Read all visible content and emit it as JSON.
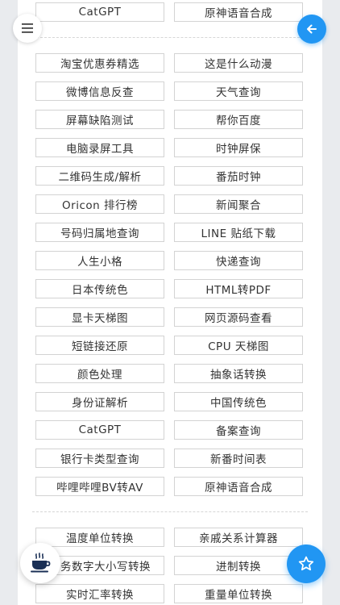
{
  "top_row": [
    "CatGPT",
    "原神语音合成"
  ],
  "tools": [
    [
      "淘宝优惠券精选",
      "这是什么动漫"
    ],
    [
      "微博信息反查",
      "天气查询"
    ],
    [
      "屏幕缺陷测试",
      "帮你百度"
    ],
    [
      "电脑录屏工具",
      "时钟屏保"
    ],
    [
      "二维码生成/解析",
      "番茄时钟"
    ],
    [
      "Oricon 排行榜",
      "新闻聚合"
    ],
    [
      "号码归属地查询",
      "LINE 贴纸下载"
    ],
    [
      "人生小格",
      "快递查询"
    ],
    [
      "日本传统色",
      "HTML转PDF"
    ],
    [
      "显卡天梯图",
      "网页源码查看"
    ],
    [
      "短链接还原",
      "CPU 天梯图"
    ],
    [
      "颜色处理",
      "抽象话转换"
    ],
    [
      "身份证解析",
      "中国传统色"
    ],
    [
      "CatGPT",
      "备案查询"
    ],
    [
      "银行卡类型查询",
      "新番时间表"
    ],
    [
      "哔哩哔哩BV转AV",
      "原神语音合成"
    ]
  ],
  "converters": [
    [
      "温度单位转换",
      "亲戚关系计算器"
    ],
    [
      "财务数字大小写转换",
      "进制转换"
    ],
    [
      "实时汇率转换",
      "重量单位转换"
    ]
  ],
  "icons": {
    "menu": "menu-icon",
    "back": "arrow-left-icon",
    "coffee": "coffee-icon",
    "star": "star-icon"
  },
  "colors": {
    "accent": "#2196f3",
    "coffee": "#1a2f55",
    "background": "#e9ebee"
  }
}
